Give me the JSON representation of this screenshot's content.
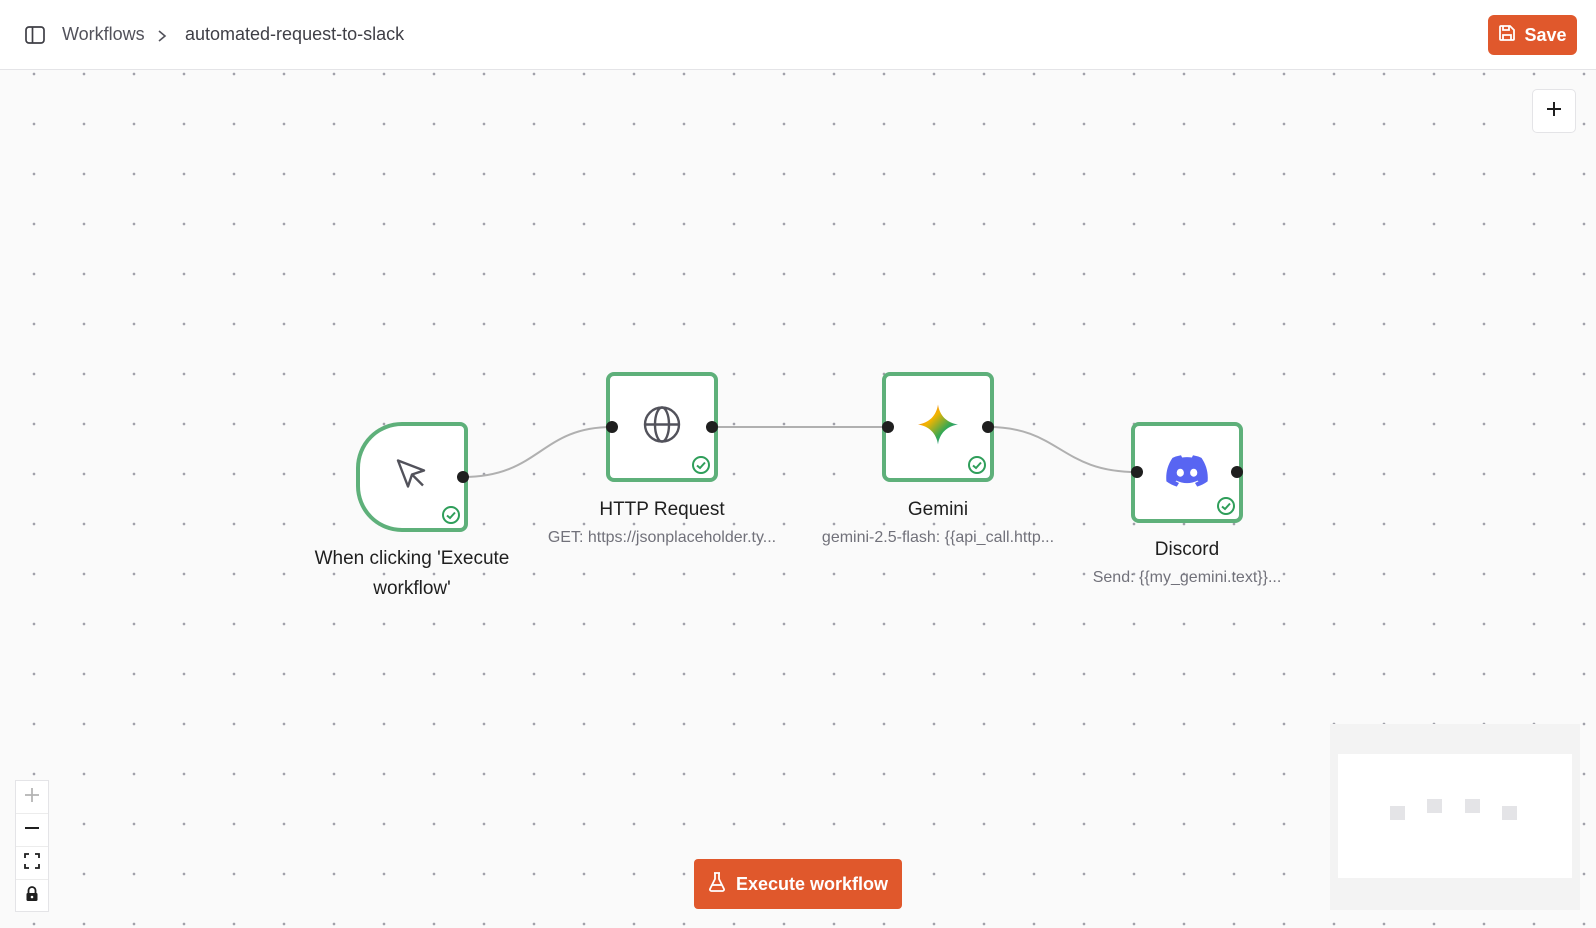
{
  "header": {
    "breadcrumb_root": "Workflows",
    "breadcrumb_current": "automated-request-to-slack",
    "save_label": "Save"
  },
  "canvas": {
    "nodes": [
      {
        "title": "When clicking 'Execute workflow'",
        "subtitle": "",
        "icon": "cursor-pointer-icon",
        "status": "success"
      },
      {
        "title": "HTTP Request",
        "subtitle": "GET: https://jsonplaceholder.ty...",
        "icon": "globe-icon",
        "status": "success"
      },
      {
        "title": "Gemini",
        "subtitle": "gemini-2.5-flash: {{api_call.http...",
        "icon": "gemini-sparkle-icon",
        "status": "success"
      },
      {
        "title": "Discord",
        "subtitle": "Send: {{my_gemini.text}}...",
        "icon": "discord-icon",
        "status": "success"
      }
    ],
    "execute_label": "Execute workflow",
    "add_node_icon": "plus-icon",
    "zoom_controls": [
      "zoom-in-icon",
      "zoom-out-icon",
      "fit-view-icon",
      "lock-icon"
    ]
  },
  "colors": {
    "accent": "#e0582c",
    "node_border": "#5eb07a",
    "success": "#2f9e5a"
  }
}
